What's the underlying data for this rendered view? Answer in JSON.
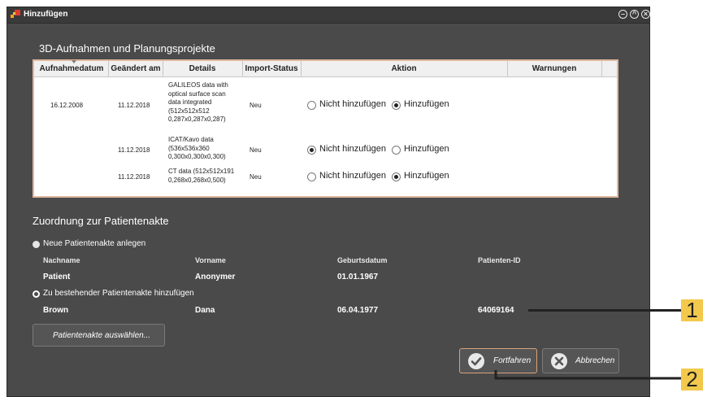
{
  "window": {
    "title": "Hinzufügen"
  },
  "section1": {
    "title": "3D-Aufnahmen und Planungsprojekte"
  },
  "table": {
    "headers": [
      "Aufnahmedatum",
      "Geändert am",
      "Details",
      "Import-Status",
      "Aktion",
      "Warnungen"
    ],
    "rows": [
      {
        "aufnahmedatum": "16.12.2008",
        "geaendert": "11.12.2018",
        "details": [
          "GALILEOS data with",
          "optical surface scan",
          "data integrated",
          "(512x512x512",
          "0,287x0,287x0,287)"
        ],
        "status": "Neu",
        "opt1": "Nicht hinzufügen",
        "opt2": "Hinzufügen",
        "selected": "opt2"
      },
      {
        "aufnahmedatum": "",
        "geaendert": "11.12.2018",
        "details": [
          "ICAT/Kavo data",
          "(536x536x360",
          "0,300x0,300x0,300)"
        ],
        "status": "Neu",
        "opt1": "Nicht hinzufügen",
        "opt2": "Hinzufügen",
        "selected": "opt1"
      },
      {
        "aufnahmedatum": "",
        "geaendert": "11.12.2018",
        "details": [
          "CT data (512x512x191",
          "0,268x0,268x0,500)"
        ],
        "status": "Neu",
        "opt1": "Nicht hinzufügen",
        "opt2": "Hinzufügen",
        "selected": "opt2"
      }
    ]
  },
  "section2": {
    "title": "Zuordnung zur Patientenakte"
  },
  "patient": {
    "new_label": "Neue Patientenakte anlegen",
    "existing_label": "Zu bestehender Patientenakte hinzufügen",
    "selected": "existing",
    "columns": [
      "Nachname",
      "Vorname",
      "Geburtsdatum",
      "Patienten-ID"
    ],
    "new_row": [
      "Patient",
      "Anonymer",
      "01.01.1967",
      ""
    ],
    "existing_row": [
      "Brown",
      "Dana",
      "06.04.1977",
      "64069164"
    ],
    "select_button": "Patientenakte auswählen..."
  },
  "buttons": {
    "continue": "Fortfahren",
    "cancel": "Abbrechen"
  },
  "callouts": [
    "1",
    "2"
  ],
  "colors": {
    "dialog_bg": "#4a4a4a",
    "accent": "#e0b99f",
    "callout": "#f2c94c"
  }
}
